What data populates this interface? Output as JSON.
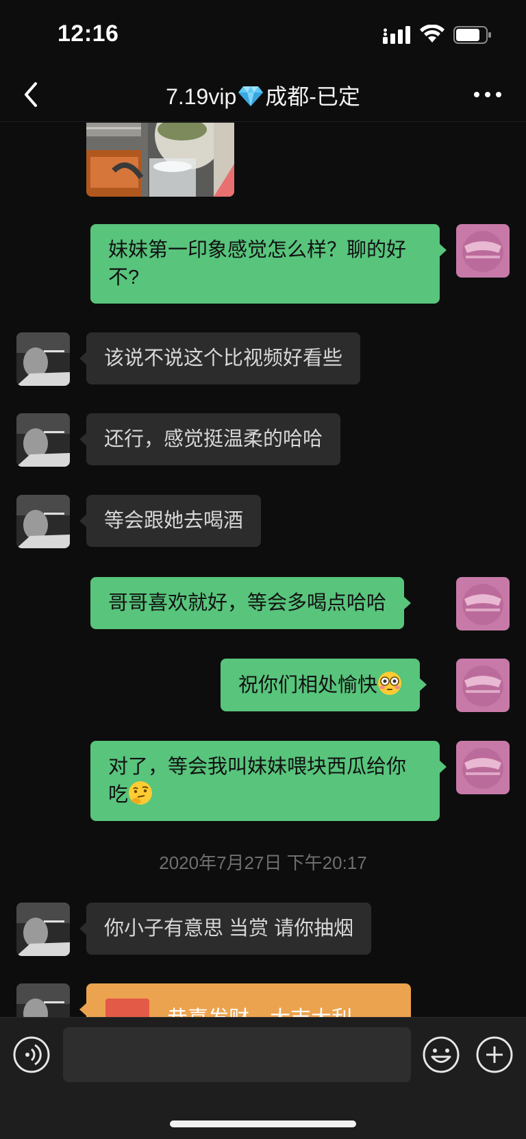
{
  "status_bar": {
    "time": "12:16"
  },
  "header": {
    "title_left": "7.19vip",
    "title_right": "成都-已定"
  },
  "messages": [
    {
      "sender": "self",
      "text": "妹妹第一印象感觉怎么样？聊的好不?"
    },
    {
      "sender": "other",
      "text": "该说不说这个比视频好看些"
    },
    {
      "sender": "other",
      "text": "还行，感觉挺温柔的哈哈"
    },
    {
      "sender": "other",
      "text": "等会跟她去喝酒"
    },
    {
      "sender": "self",
      "text": "哥哥喜欢就好，等会多喝点哈哈"
    },
    {
      "sender": "self",
      "text": "祝你们相处愉快",
      "emoji": "flushed-face"
    },
    {
      "sender": "self",
      "text": "对了，等会我叫妹妹喂块西瓜给你吃",
      "emoji": "thinking-face"
    },
    {
      "sender": "other",
      "text": "你小子有意思 当赏 请你抽烟"
    }
  ],
  "time_divider": "2020年7月27日 下午20:17",
  "red_packet": {
    "text": "恭喜发财，大吉大利"
  },
  "input_bar": {
    "placeholder": ""
  },
  "colors": {
    "self_bubble": "#58c47c",
    "other_bubble": "#2c2c2c",
    "red_packet": "#eca34f",
    "background": "#0d0d0d"
  }
}
